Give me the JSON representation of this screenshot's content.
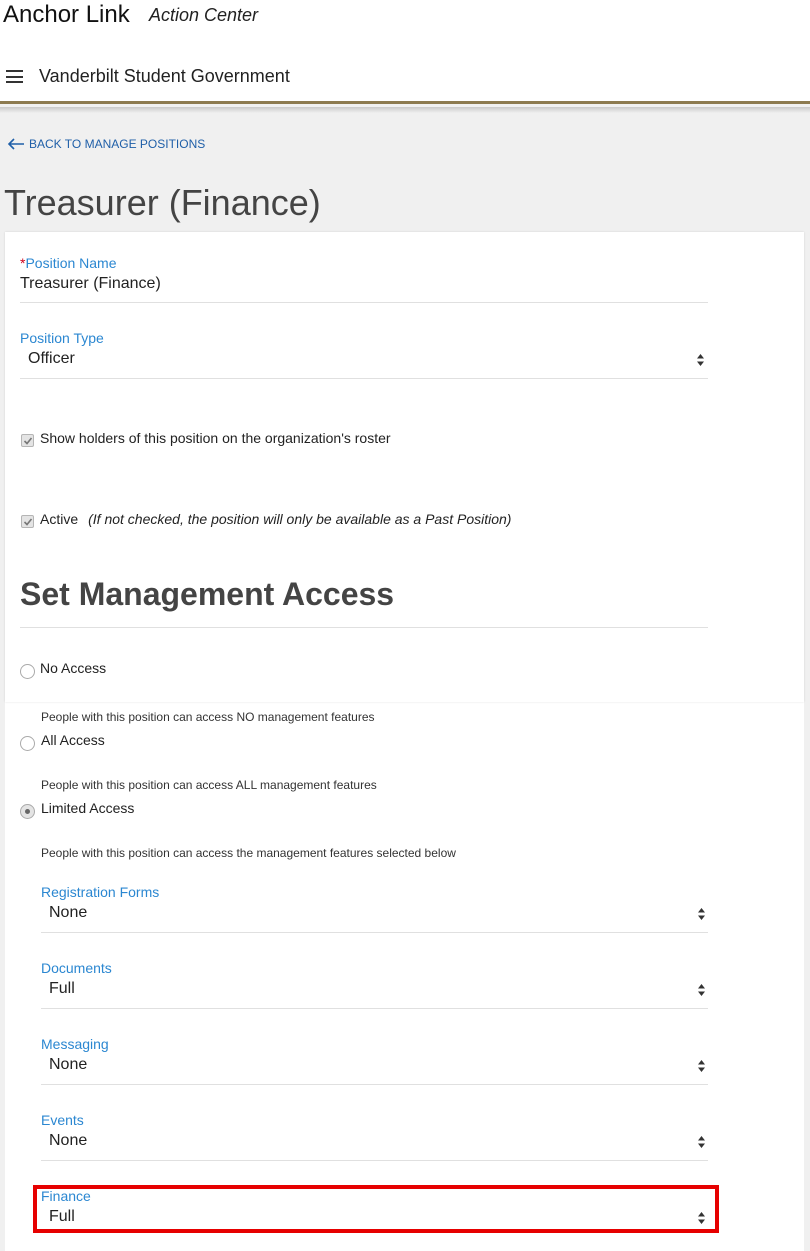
{
  "header": {
    "brand": "Anchor Link",
    "section": "Action Center",
    "org_name": "Vanderbilt Student Government",
    "accent_color": "#8c7a4f"
  },
  "nav": {
    "back_label": "BACK TO MANAGE POSITIONS",
    "back_icon": "arrow-left-icon"
  },
  "page": {
    "title": "Treasurer (Finance)"
  },
  "form": {
    "position_name": {
      "required_mark": "*",
      "label": "Position Name",
      "value": "Treasurer (Finance)"
    },
    "position_type": {
      "label": "Position Type",
      "value": "Officer"
    },
    "show_on_roster": {
      "checked": true,
      "label": "Show holders of this position on the organization's roster"
    },
    "active": {
      "checked": true,
      "label": "Active",
      "note": "(If not checked, the position will only be available as a Past Position)"
    }
  },
  "management_access": {
    "title": "Set Management Access",
    "options": [
      {
        "label": "No Access",
        "description": "People with this position can access NO management features",
        "selected": false
      },
      {
        "label": "All Access",
        "description": "People with this position can access ALL management features",
        "selected": false
      },
      {
        "label": "Limited Access",
        "description": "People with this position can access the management features selected below",
        "selected": true
      }
    ],
    "features": [
      {
        "label": "Registration Forms",
        "value": "None"
      },
      {
        "label": "Documents",
        "value": "Full"
      },
      {
        "label": "Messaging",
        "value": "None"
      },
      {
        "label": "Events",
        "value": "None"
      },
      {
        "label": "Finance",
        "value": "Full",
        "highlighted": true
      }
    ]
  },
  "colors": {
    "label_blue": "#2b87d1",
    "link_blue": "#1f5fa8",
    "highlight_red": "#e60000"
  }
}
